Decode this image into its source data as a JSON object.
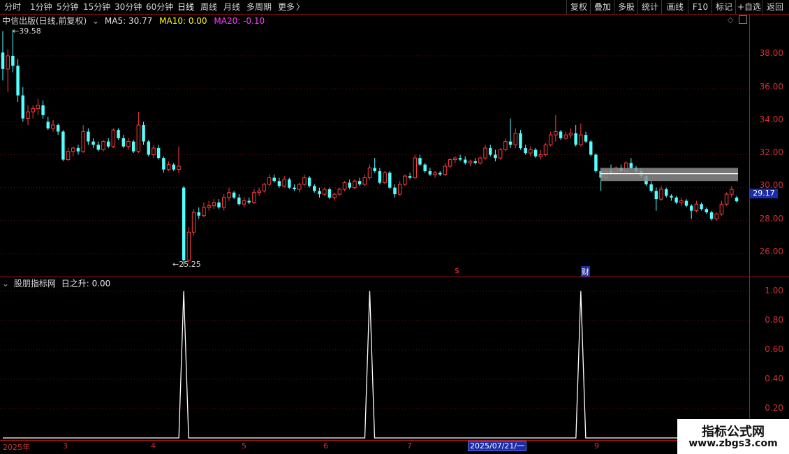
{
  "toolbar": {
    "periods": [
      "分时",
      "1分钟",
      "5分钟",
      "15分钟",
      "30分钟",
      "60分钟",
      "日线",
      "周线",
      "月线",
      "多周期",
      "更多"
    ],
    "active_period": "日线",
    "more_arrow": "〉",
    "right_buttons": [
      "复权",
      "叠加",
      "多股",
      "统计",
      "画线",
      "F10",
      "标记",
      "+自选",
      "返回"
    ]
  },
  "main": {
    "stock_title": "中信出版(日线,前复权)",
    "ma5": "MA5: 30.77",
    "ma10": "MA10: 0.00",
    "ma20": "MA20: -0.10",
    "high_label": "39.58",
    "low_label": "25.25",
    "current_price": "29.17",
    "event_marker_s": "$",
    "event_marker_cai": "财",
    "y_ticks": [
      "38.00",
      "36.00",
      "34.00",
      "32.00",
      "30.00",
      "28.00",
      "26.00"
    ]
  },
  "sub": {
    "title": "股朋指标网",
    "indicator": "日之升: 0.00",
    "y_ticks": [
      "1.00",
      "0.80",
      "0.60",
      "0.40",
      "0.20"
    ]
  },
  "xaxis": {
    "labels": [
      "2025年",
      "3",
      "4",
      "5",
      "6",
      "7",
      "9"
    ],
    "cursor_date": "2025/07/21/一"
  },
  "watermark": {
    "line1": "指标公式网",
    "line2": "www.zbgs3.com"
  },
  "colors": {
    "up": "#ff3c3c",
    "down": "#54ffff",
    "ma10": "#ffff00",
    "ma20": "#ff40ff",
    "axis": "#b01414"
  },
  "chart_data": {
    "type": "candlestick",
    "title": "中信出版(日线,前复权)",
    "price_range": [
      24.6,
      40.5
    ],
    "y_ticks": [
      38,
      36,
      34,
      32,
      30,
      28,
      26
    ],
    "high": 39.58,
    "low": 25.25,
    "last": 29.17,
    "ohlc": [
      [
        38.2,
        39.5,
        36.5,
        37.2
      ],
      [
        37.2,
        38.4,
        35.8,
        38.0
      ],
      [
        38.0,
        39.58,
        37.0,
        37.4
      ],
      [
        37.4,
        37.8,
        35.2,
        35.6
      ],
      [
        35.6,
        36.1,
        34.0,
        34.2
      ],
      [
        34.2,
        35.0,
        33.8,
        34.6
      ],
      [
        34.6,
        35.0,
        34.2,
        34.8
      ],
      [
        34.8,
        35.4,
        34.4,
        35.0
      ],
      [
        35.0,
        35.3,
        34.2,
        34.4
      ],
      [
        34.0,
        34.3,
        33.5,
        33.6
      ],
      [
        33.6,
        34.1,
        33.4,
        33.8
      ],
      [
        33.8,
        33.9,
        33.2,
        33.4
      ],
      [
        33.4,
        33.5,
        31.6,
        31.7
      ],
      [
        31.7,
        32.4,
        31.6,
        32.2
      ],
      [
        32.2,
        32.5,
        31.9,
        32.4
      ],
      [
        32.4,
        32.6,
        32.0,
        32.2
      ],
      [
        32.2,
        33.8,
        32.1,
        33.4
      ],
      [
        33.4,
        33.6,
        32.6,
        32.8
      ],
      [
        32.8,
        33.0,
        32.4,
        32.6
      ],
      [
        32.6,
        32.8,
        32.2,
        32.3
      ],
      [
        32.3,
        32.9,
        32.2,
        32.8
      ],
      [
        32.8,
        33.0,
        32.4,
        32.5
      ],
      [
        32.5,
        33.6,
        32.4,
        33.5
      ],
      [
        33.5,
        33.6,
        32.9,
        33.0
      ],
      [
        33.0,
        33.2,
        32.4,
        32.5
      ],
      [
        32.5,
        33.0,
        32.3,
        32.8
      ],
      [
        32.8,
        32.9,
        32.1,
        32.2
      ],
      [
        32.2,
        34.6,
        32.1,
        33.8
      ],
      [
        33.8,
        34.0,
        32.6,
        32.8
      ],
      [
        32.8,
        32.9,
        31.9,
        32.0
      ],
      [
        32.0,
        32.6,
        31.8,
        32.4
      ],
      [
        32.4,
        32.6,
        31.7,
        31.8
      ],
      [
        31.8,
        31.9,
        30.9,
        31.1
      ],
      [
        31.1,
        31.6,
        31.0,
        31.4
      ],
      [
        31.4,
        31.5,
        31.0,
        31.1
      ],
      [
        31.1,
        32.5,
        30.9,
        31.3
      ],
      [
        30.0,
        30.1,
        25.25,
        25.6
      ],
      [
        25.6,
        27.6,
        25.4,
        27.3
      ],
      [
        27.3,
        28.7,
        27.1,
        28.5
      ],
      [
        28.5,
        28.8,
        28.1,
        28.3
      ],
      [
        28.3,
        29.1,
        28.2,
        28.8
      ],
      [
        28.8,
        29.2,
        28.6,
        28.9
      ],
      [
        28.9,
        29.3,
        28.7,
        29.1
      ],
      [
        29.1,
        29.3,
        28.7,
        28.8
      ],
      [
        28.8,
        29.6,
        28.6,
        29.4
      ],
      [
        29.4,
        30.0,
        29.2,
        29.7
      ],
      [
        29.7,
        29.8,
        29.3,
        29.4
      ],
      [
        29.4,
        29.6,
        28.9,
        29.0
      ],
      [
        29.0,
        29.4,
        28.8,
        29.2
      ],
      [
        29.2,
        29.4,
        29.0,
        29.1
      ],
      [
        29.1,
        29.9,
        29.0,
        29.7
      ],
      [
        29.7,
        30.0,
        29.5,
        29.8
      ],
      [
        29.8,
        30.3,
        29.7,
        30.2
      ],
      [
        30.2,
        30.8,
        30.1,
        30.6
      ],
      [
        30.6,
        30.8,
        30.3,
        30.4
      ],
      [
        30.4,
        30.6,
        30.0,
        30.1
      ],
      [
        30.1,
        30.7,
        30.0,
        30.5
      ],
      [
        30.5,
        30.6,
        29.9,
        30.0
      ],
      [
        30.0,
        30.2,
        29.8,
        29.9
      ],
      [
        29.9,
        30.3,
        29.7,
        30.2
      ],
      [
        30.2,
        30.8,
        30.1,
        30.6
      ],
      [
        30.6,
        30.7,
        30.0,
        30.1
      ],
      [
        30.1,
        30.2,
        29.7,
        29.8
      ],
      [
        29.8,
        30.0,
        29.4,
        29.6
      ],
      [
        29.6,
        30.0,
        29.5,
        29.9
      ],
      [
        29.9,
        30.0,
        29.3,
        29.4
      ],
      [
        29.4,
        29.7,
        29.2,
        29.6
      ],
      [
        29.6,
        30.0,
        29.5,
        29.9
      ],
      [
        29.9,
        30.4,
        29.8,
        30.3
      ],
      [
        30.3,
        30.5,
        29.9,
        30.0
      ],
      [
        30.0,
        30.5,
        29.9,
        30.4
      ],
      [
        30.4,
        30.6,
        30.1,
        30.2
      ],
      [
        30.2,
        30.8,
        30.1,
        30.6
      ],
      [
        30.6,
        31.4,
        30.5,
        31.2
      ],
      [
        31.2,
        31.8,
        30.9,
        31.0
      ],
      [
        31.0,
        31.2,
        30.2,
        30.3
      ],
      [
        30.3,
        31.0,
        30.2,
        30.9
      ],
      [
        30.9,
        31.0,
        29.9,
        30.0
      ],
      [
        30.0,
        30.2,
        29.4,
        29.6
      ],
      [
        29.6,
        30.4,
        29.5,
        30.2
      ],
      [
        30.2,
        30.8,
        30.1,
        30.7
      ],
      [
        30.7,
        30.9,
        30.5,
        30.6
      ],
      [
        30.6,
        32.0,
        30.5,
        31.8
      ],
      [
        31.8,
        32.0,
        31.3,
        31.4
      ],
      [
        31.4,
        31.5,
        30.9,
        31.0
      ],
      [
        31.0,
        31.2,
        30.7,
        30.8
      ],
      [
        30.8,
        31.0,
        30.6,
        30.9
      ],
      [
        30.9,
        31.0,
        30.7,
        30.8
      ],
      [
        30.8,
        31.5,
        30.7,
        31.3
      ],
      [
        31.3,
        31.8,
        31.2,
        31.7
      ],
      [
        31.7,
        31.9,
        31.5,
        31.8
      ],
      [
        31.8,
        32.0,
        31.6,
        31.7
      ],
      [
        31.7,
        31.9,
        31.4,
        31.5
      ],
      [
        31.5,
        31.7,
        31.3,
        31.6
      ],
      [
        31.6,
        31.8,
        31.4,
        31.5
      ],
      [
        31.5,
        31.9,
        31.4,
        31.8
      ],
      [
        31.8,
        32.6,
        31.7,
        32.4
      ],
      [
        32.4,
        32.6,
        31.9,
        32.0
      ],
      [
        32.0,
        32.3,
        31.6,
        31.8
      ],
      [
        31.8,
        32.4,
        31.7,
        32.3
      ],
      [
        32.3,
        33.0,
        32.2,
        32.8
      ],
      [
        32.8,
        34.2,
        32.4,
        32.6
      ],
      [
        32.6,
        33.6,
        32.4,
        33.3
      ],
      [
        33.3,
        33.5,
        32.3,
        32.4
      ],
      [
        32.4,
        32.6,
        32.0,
        32.1
      ],
      [
        32.1,
        32.5,
        31.9,
        32.3
      ],
      [
        32.3,
        32.4,
        31.8,
        31.9
      ],
      [
        31.9,
        32.3,
        31.7,
        32.0
      ],
      [
        32.0,
        32.7,
        31.9,
        32.6
      ],
      [
        32.6,
        33.4,
        32.5,
        33.2
      ],
      [
        33.2,
        34.4,
        32.8,
        33.4
      ],
      [
        33.4,
        33.5,
        32.9,
        33.0
      ],
      [
        33.0,
        33.4,
        32.9,
        33.2
      ],
      [
        33.2,
        33.6,
        33.0,
        33.3
      ],
      [
        33.3,
        33.8,
        32.5,
        32.6
      ],
      [
        32.6,
        33.9,
        32.5,
        33.2
      ],
      [
        33.2,
        33.4,
        32.7,
        32.8
      ],
      [
        32.8,
        32.9,
        31.9,
        32.0
      ],
      [
        32.0,
        32.1,
        30.9,
        31.0
      ],
      [
        31.0,
        31.2,
        29.8,
        30.6
      ],
      [
        30.6,
        31.1,
        30.5,
        31.0
      ],
      [
        31.0,
        31.4,
        30.8,
        30.9
      ],
      [
        30.9,
        31.3,
        30.8,
        31.2
      ],
      [
        31.2,
        31.4,
        30.9,
        31.0
      ],
      [
        31.0,
        31.6,
        30.9,
        31.5
      ],
      [
        31.5,
        31.8,
        31.1,
        31.2
      ],
      [
        31.2,
        31.3,
        30.9,
        31.0
      ],
      [
        31.0,
        31.2,
        30.6,
        30.7
      ],
      [
        30.7,
        30.8,
        30.1,
        30.2
      ],
      [
        30.2,
        30.4,
        29.7,
        29.8
      ],
      [
        29.8,
        30.0,
        28.6,
        29.3
      ],
      [
        29.3,
        30.1,
        29.2,
        29.9
      ],
      [
        29.9,
        30.0,
        29.4,
        29.5
      ],
      [
        29.5,
        29.6,
        29.2,
        29.4
      ],
      [
        29.4,
        29.5,
        29.0,
        29.1
      ],
      [
        29.1,
        29.4,
        28.9,
        29.2
      ],
      [
        29.2,
        29.3,
        28.8,
        28.9
      ],
      [
        28.9,
        29.0,
        28.1,
        28.6
      ],
      [
        28.6,
        29.2,
        28.5,
        29.0
      ],
      [
        29.0,
        29.1,
        28.6,
        28.7
      ],
      [
        28.7,
        28.8,
        28.4,
        28.5
      ],
      [
        28.5,
        28.6,
        28.0,
        28.1
      ],
      [
        28.1,
        28.5,
        28.0,
        28.4
      ],
      [
        28.4,
        29.2,
        28.3,
        29.0
      ],
      [
        29.0,
        29.7,
        28.9,
        29.6
      ],
      [
        29.6,
        30.1,
        29.4,
        29.9
      ],
      [
        29.4,
        29.5,
        29.1,
        29.17
      ]
    ],
    "indicator": {
      "name": "日之升",
      "range": [
        0,
        1.08
      ],
      "y_ticks": [
        1.0,
        0.8,
        0.6,
        0.4,
        0.2
      ],
      "spikes_at_index": [
        36,
        73,
        115
      ],
      "spike_value": 1.0,
      "last_value": 0.0
    },
    "x_labels": [
      "2025年",
      "3",
      "4",
      "5",
      "6",
      "7",
      "9"
    ]
  }
}
